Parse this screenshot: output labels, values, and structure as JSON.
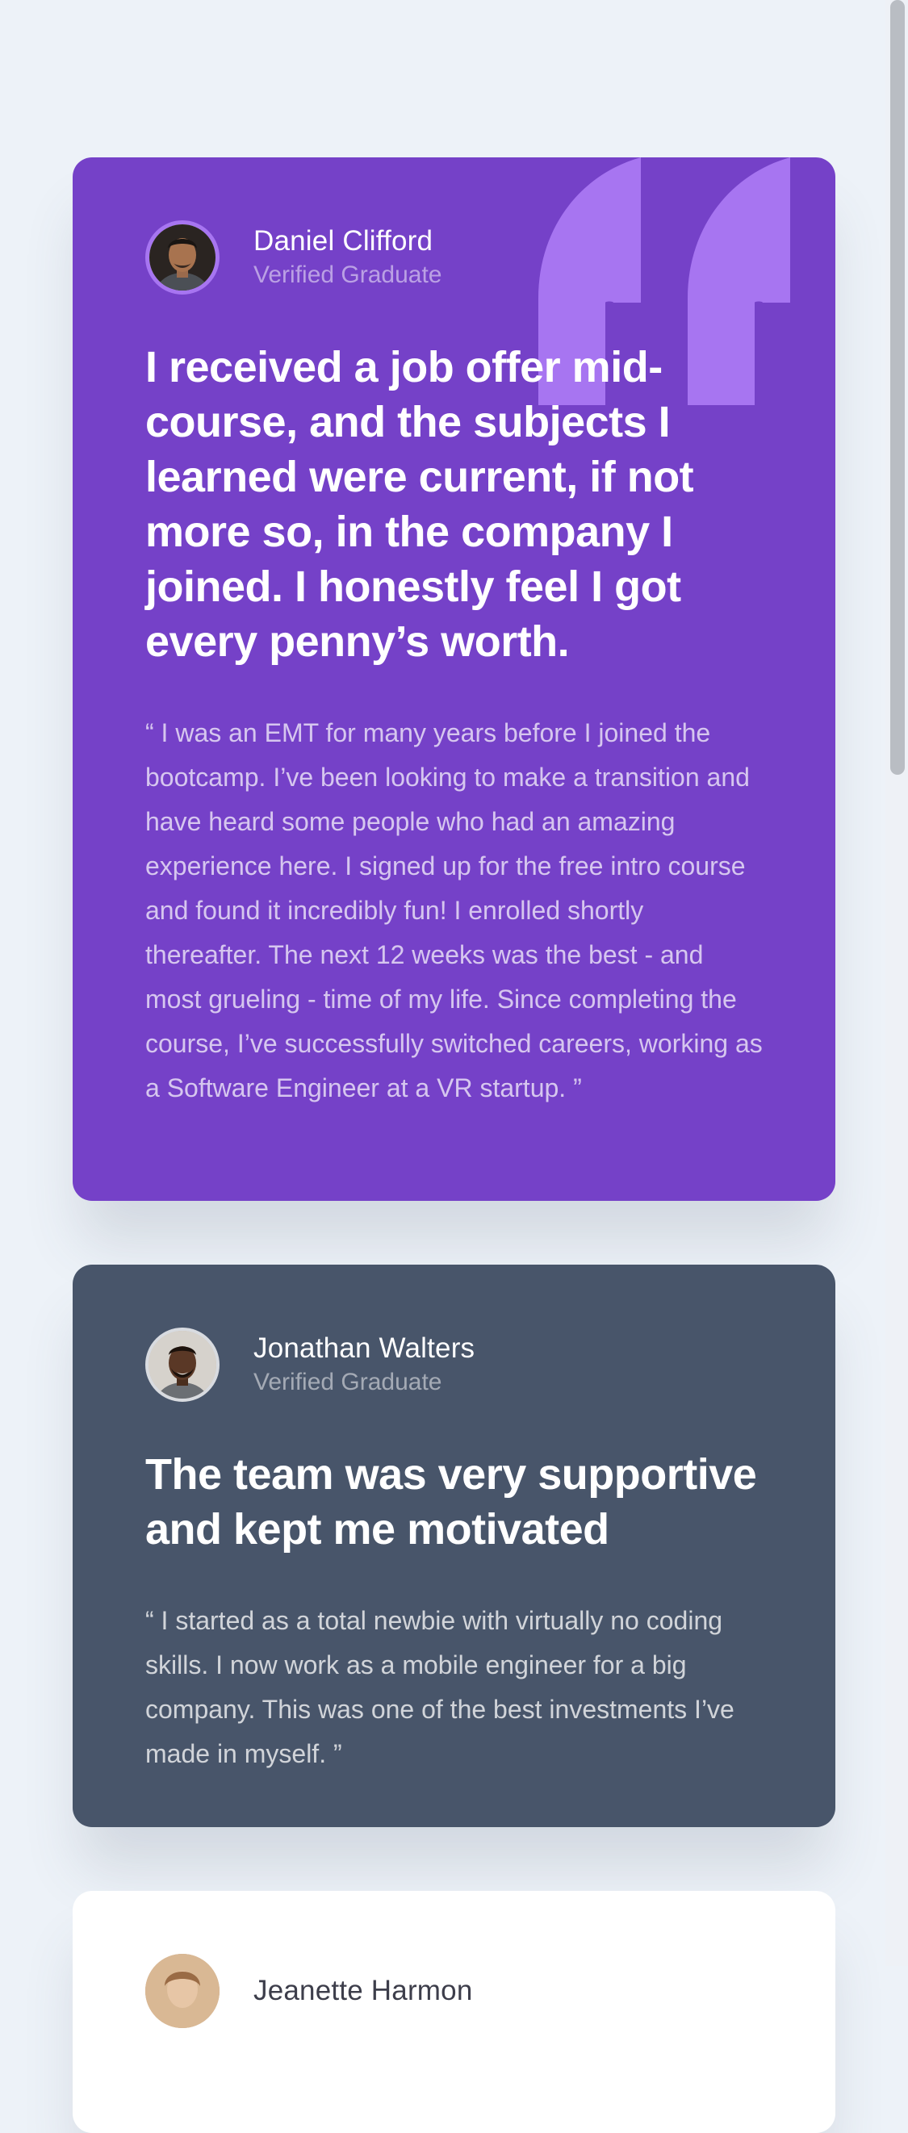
{
  "testimonials": [
    {
      "name": "Daniel Clifford",
      "role": "Verified Graduate",
      "headline": "I received a job offer mid-course, and the subjects I learned were current, if not more so, in the company I joined. I honestly feel I got every penny’s worth.",
      "body": "“ I was an EMT for many years before I joined the bootcamp. I’ve been looking to make a transition and have heard some people who had an amazing experience here. I signed up for the free intro course and found it incredibly fun! I enrolled shortly thereafter. The next 12 weeks was the best - and most grueling - time of my life. Since completing the course, I’ve successfully switched careers, working as a Software Engineer at a VR startup. ”",
      "background": "#7541c8",
      "accent": "#a775f1"
    },
    {
      "name": "Jonathan Walters",
      "role": "Verified Graduate",
      "headline": "The team was very supportive and kept me motivated",
      "body": "“ I started as a total newbie with virtually no coding skills. I now work as a mobile engineer for a big company. This was one of the best investments I’ve made in myself. ”",
      "background": "#48556a"
    },
    {
      "name": "Jeanette Harmon",
      "background": "#ffffff"
    }
  ],
  "icons": {
    "quote": "quotation-mark-icon",
    "avatar": "avatar-photo"
  },
  "colors": {
    "page_background": "#edf2f8",
    "purple": "#7541c8",
    "purple_accent": "#a775f1",
    "dark_gray": "#48556a"
  }
}
